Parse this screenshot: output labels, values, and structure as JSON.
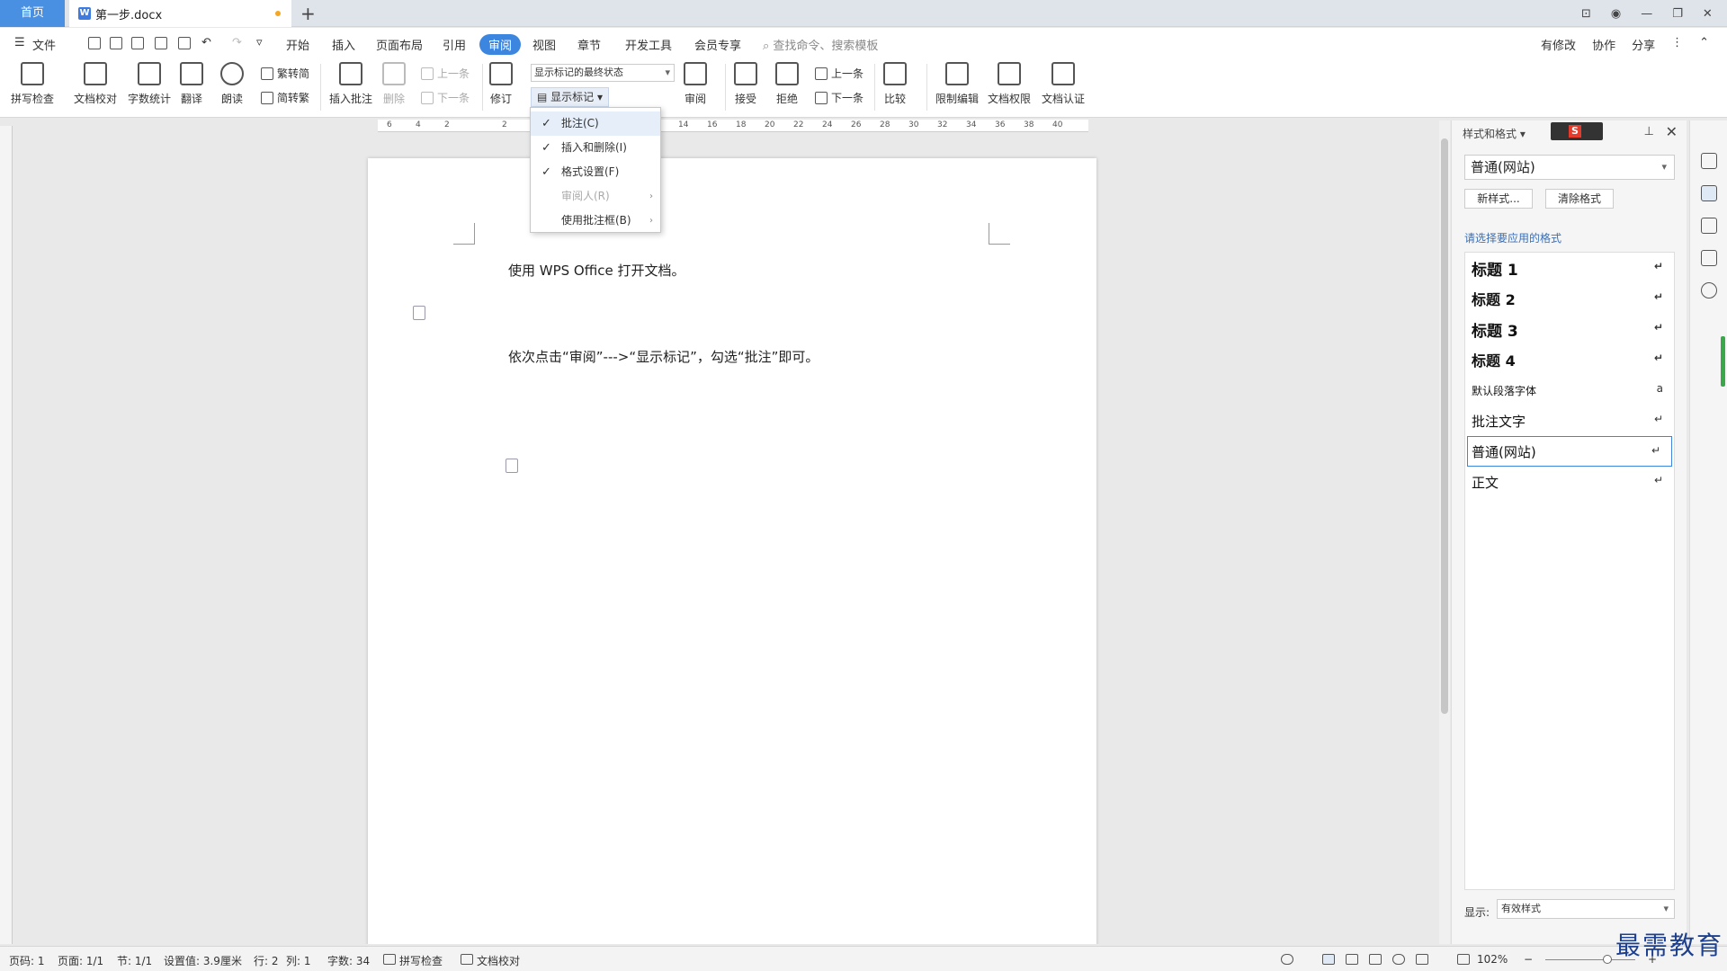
{
  "tabs": {
    "home": "首页",
    "doc_title": "第一步.docx"
  },
  "menu": {
    "file": "文件",
    "items": [
      "开始",
      "插入",
      "页面布局",
      "引用",
      "审阅",
      "视图",
      "章节",
      "开发工具",
      "会员专享"
    ],
    "active": "审阅",
    "search_placeholder": "查找命令、搜索模板",
    "right_links": [
      "有修改",
      "协作",
      "分享"
    ]
  },
  "ribbon": {
    "spellcheck": "拼写检查",
    "proofread": "文档校对",
    "wordcount": "字数统计",
    "translate": "翻译",
    "read_aloud": "朗读",
    "trad_to_simp": "繁转简",
    "simp_to_trad": "简转繁",
    "insert_comment": "插入批注",
    "delete": "删除",
    "prev": "上一条",
    "next": "下一条",
    "revise": "修订",
    "markup_state": "显示标记的最终状态",
    "show_markup": "显示标记",
    "review": "审阅",
    "accept": "接受",
    "reject": "拒绝",
    "prev2": "上一条",
    "next2": "下一条",
    "compare": "比较",
    "restrict_edit": "限制编辑",
    "doc_permission": "文档权限",
    "doc_certify": "文档认证"
  },
  "dropdown": {
    "items": [
      {
        "label": "批注(C)",
        "checked": true,
        "disabled": false,
        "submenu": false
      },
      {
        "label": "插入和删除(I)",
        "checked": true,
        "disabled": false,
        "submenu": false
      },
      {
        "label": "格式设置(F)",
        "checked": true,
        "disabled": false,
        "submenu": false
      },
      {
        "label": "审阅人(R)",
        "checked": false,
        "disabled": true,
        "submenu": true
      },
      {
        "label": "使用批注框(B)",
        "checked": false,
        "disabled": false,
        "submenu": true
      }
    ]
  },
  "ruler": {
    "ticks": [
      "6",
      "4",
      "2",
      "2",
      "14",
      "16",
      "18",
      "20",
      "22",
      "24",
      "26",
      "28",
      "30",
      "32",
      "34",
      "36",
      "38",
      "40"
    ]
  },
  "document": {
    "line1": "使用 WPS Office 打开文档。",
    "line2": "依次点击“审阅”--->“显示标记”，勾选“批注”即可。"
  },
  "styles_panel": {
    "title": "样式和格式",
    "current_style": "普通(网站)",
    "new_style": "新样式...",
    "clear_format": "清除格式",
    "apply_label": "请选择要应用的格式",
    "styles": [
      {
        "name": "标题  1",
        "weight": "bold",
        "size": 17,
        "mark": "↵"
      },
      {
        "name": "标题  2",
        "weight": "bold",
        "size": 16,
        "mark": "↵"
      },
      {
        "name": "标题  3",
        "weight": "bold",
        "size": 17,
        "mark": "↵"
      },
      {
        "name": "标题  4",
        "weight": "bold",
        "size": 16,
        "mark": "↵"
      },
      {
        "name": "默认段落字体",
        "weight": "normal",
        "size": 12,
        "mark": "a"
      },
      {
        "name": "批注文字",
        "weight": "normal",
        "size": 15,
        "mark": "↵"
      },
      {
        "name": "普通(网站)",
        "weight": "normal",
        "size": 15,
        "mark": "↵"
      },
      {
        "name": "正文",
        "weight": "normal",
        "size": 15,
        "mark": "↵"
      }
    ],
    "selected_index": 6,
    "show_label": "显示:",
    "show_value": "有效样式"
  },
  "statusbar": {
    "page": "页码: 1",
    "pages": "页面: 1/1",
    "section": "节: 1/1",
    "setting": "设置值: 3.9厘米",
    "row": "行: 2",
    "col": "列: 1",
    "words": "字数: 34",
    "spellcheck": "拼写检查",
    "proofread": "文档校对",
    "zoom": "102%"
  },
  "watermark": "最需教育"
}
